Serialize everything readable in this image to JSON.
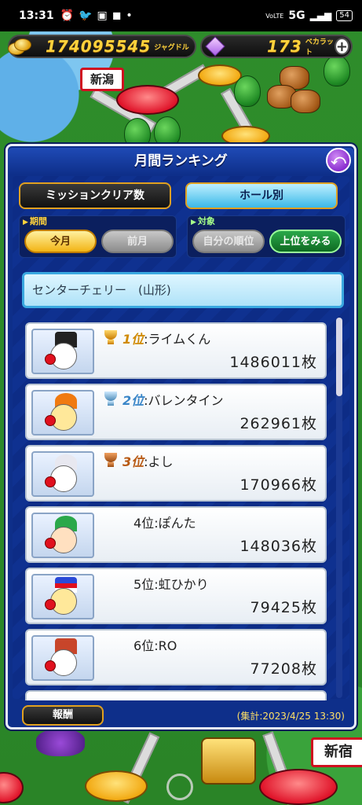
{
  "status_bar": {
    "time": "13:31",
    "network": "5G",
    "battery": "54"
  },
  "currency": {
    "jugdoll_value": "174095545",
    "jugdoll_unit": "ジャグドル",
    "becarat_value": "173",
    "becarat_unit": "ベカラット",
    "plus_label": "+"
  },
  "map": {
    "city_niigata": "新潟",
    "city_shinjuku": "新宿"
  },
  "panel": {
    "title": "月間ランキング",
    "back_label": "⤺",
    "tabs": [
      {
        "label": "ミッションクリア数",
        "active": false
      },
      {
        "label": "ホール別",
        "active": true
      }
    ],
    "period": {
      "label": "期間",
      "options": [
        "今月",
        "前月"
      ],
      "selected": "今月"
    },
    "target": {
      "label": "対象",
      "options": [
        "自分の順位",
        "上位をみる"
      ],
      "selected": "上位をみる"
    },
    "hall_name": "センターチェリー　(山形)",
    "rankings": [
      {
        "place": "1位",
        "name": ":ライムくん",
        "score": "1486011枚",
        "medal": "gold"
      },
      {
        "place": "2位",
        "name": ":バレンタイン",
        "score": "262961枚",
        "medal": "silver"
      },
      {
        "place": "3位",
        "name": ":よし",
        "score": "170966枚",
        "medal": "bronze"
      },
      {
        "place": "4位",
        "name": ":ぽんた",
        "score": "148036枚",
        "medal": "none"
      },
      {
        "place": "5位",
        "name": ":虹ひかり",
        "score": "79425枚",
        "medal": "none"
      },
      {
        "place": "6位",
        "name": ":RO",
        "score": "77208枚",
        "medal": "none"
      }
    ],
    "reward_label": "報酬",
    "tally": "(集計:2023/4/25 13:30)"
  },
  "colors": {
    "panel_bg": "#0e2f8a",
    "accent_gold": "#e0a020",
    "tab_active": "#3ab8e8"
  }
}
